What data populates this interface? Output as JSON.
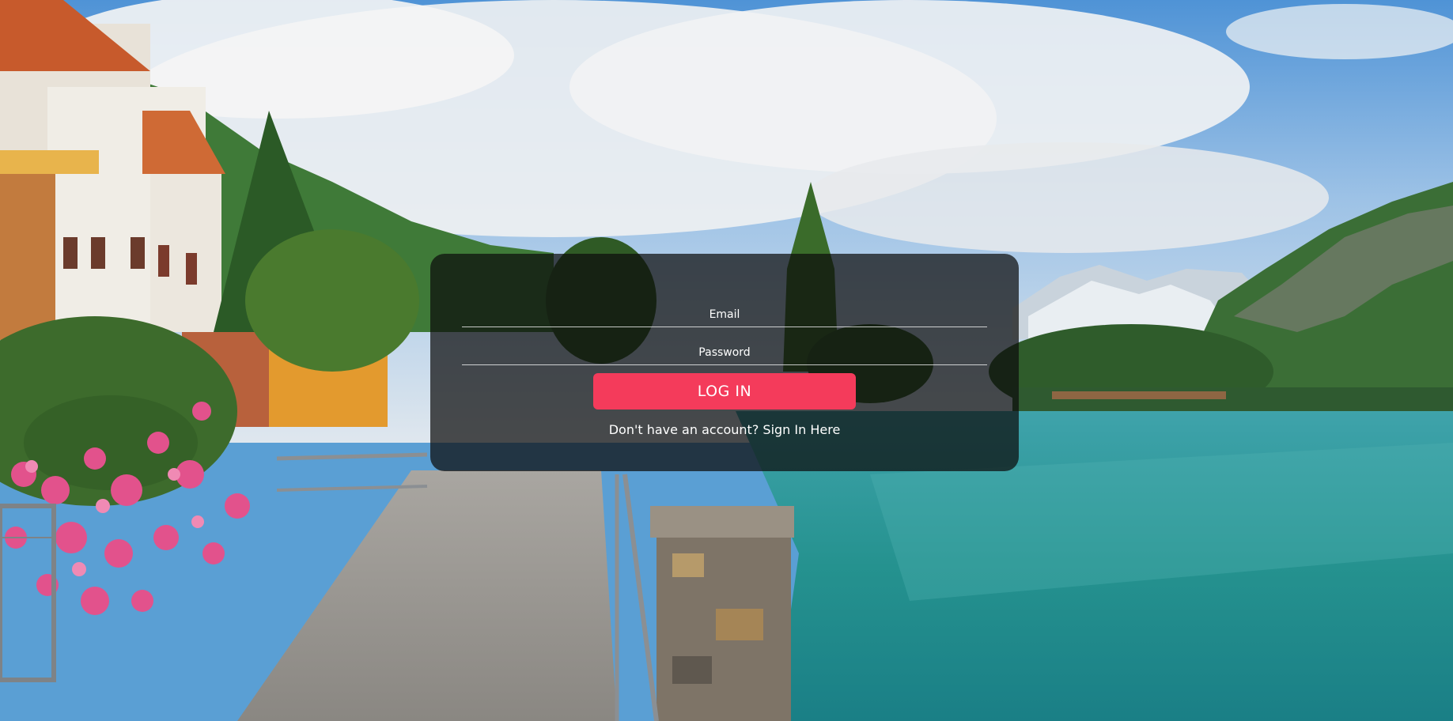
{
  "login": {
    "email_placeholder": "Email",
    "password_placeholder": "Password",
    "login_button_label": "LOG IN",
    "signup_prompt": "Don't have an account?",
    "signup_link_label": "Sign In Here"
  },
  "colors": {
    "accent": "#f43b5b",
    "card_background": "rgba(12,12,12,0.72)"
  }
}
